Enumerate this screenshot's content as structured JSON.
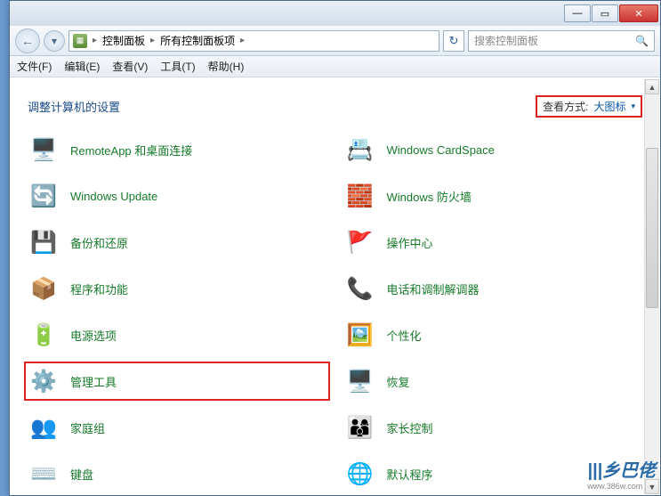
{
  "titlebar": {
    "minimize": "—",
    "maximize": "▭",
    "close": "✕"
  },
  "nav": {
    "back": "←",
    "forward": "▾"
  },
  "address": {
    "crumb1": "控制面板",
    "crumb2": "所有控制面板项",
    "sep": "▸"
  },
  "refresh": "↻",
  "search": {
    "placeholder": "搜索控制面板",
    "icon": "🔍"
  },
  "menu": {
    "file": "文件(F)",
    "edit": "编辑(E)",
    "view": "查看(V)",
    "tools": "工具(T)",
    "help": "帮助(H)"
  },
  "header": {
    "title": "调整计算机的设置",
    "view_label": "查看方式:",
    "view_value": "大图标",
    "view_arrow": "▾"
  },
  "items": [
    {
      "label": "RemoteApp 和桌面连接",
      "icon": "🖥️"
    },
    {
      "label": "Windows CardSpace",
      "icon": "📇"
    },
    {
      "label": "Windows Update",
      "icon": "🔄"
    },
    {
      "label": "Windows 防火墙",
      "icon": "🧱"
    },
    {
      "label": "备份和还原",
      "icon": "💾"
    },
    {
      "label": "操作中心",
      "icon": "🚩"
    },
    {
      "label": "程序和功能",
      "icon": "📦"
    },
    {
      "label": "电话和调制解调器",
      "icon": "📞"
    },
    {
      "label": "电源选项",
      "icon": "🔋"
    },
    {
      "label": "个性化",
      "icon": "🖼️"
    },
    {
      "label": "管理工具",
      "icon": "⚙️"
    },
    {
      "label": "恢复",
      "icon": "🖥️"
    },
    {
      "label": "家庭组",
      "icon": "👥"
    },
    {
      "label": "家长控制",
      "icon": "👨‍👩‍👦"
    },
    {
      "label": "键盘",
      "icon": "⌨️"
    },
    {
      "label": "默认程序",
      "icon": "🌐"
    }
  ],
  "watermark": {
    "text": "乡巴佬",
    "sub": "www.386w.com"
  }
}
